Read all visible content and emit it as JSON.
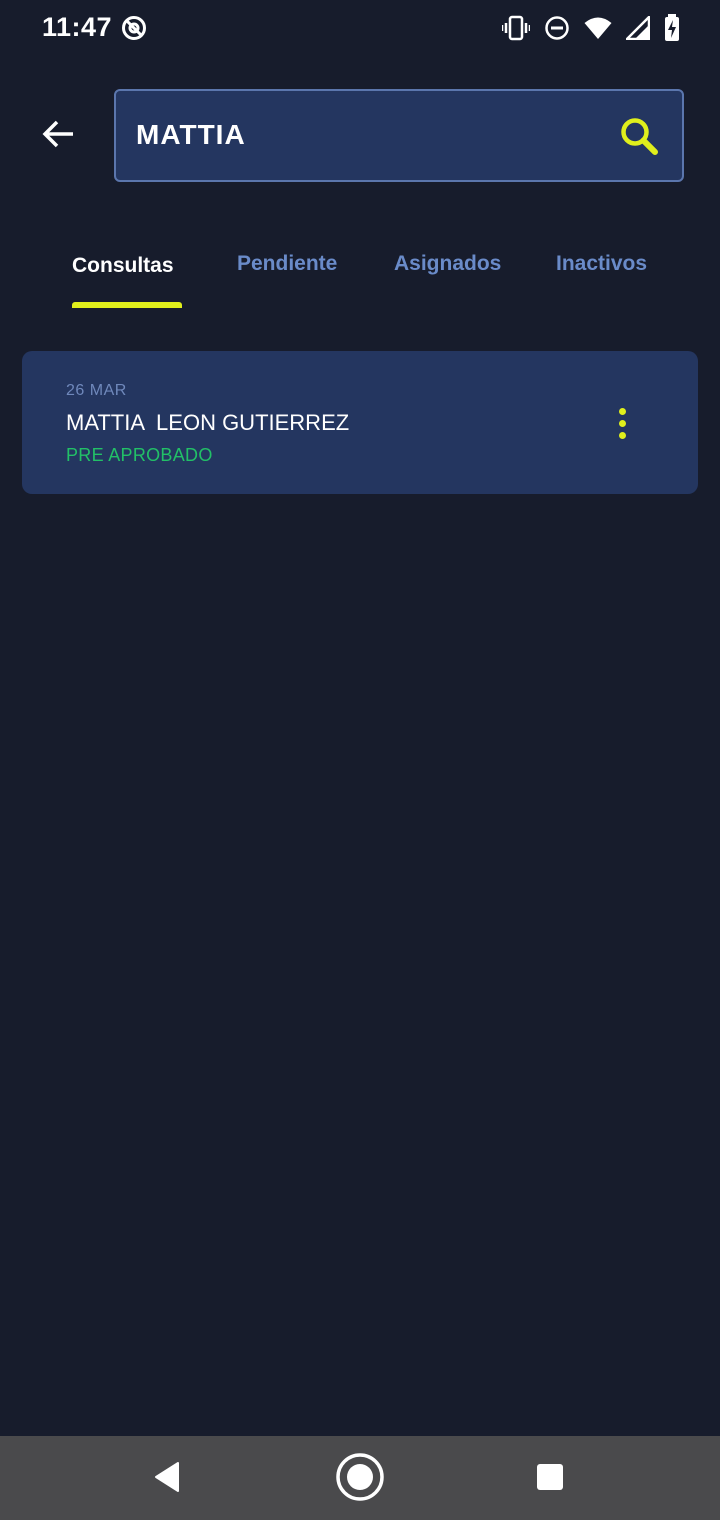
{
  "status_bar": {
    "time": "11:47",
    "left_icon": "at-sign-icon",
    "right_icons": [
      "vibrate-icon",
      "do-not-disturb-icon",
      "wifi-icon",
      "cell-signal-icon",
      "battery-charging-icon"
    ]
  },
  "header": {
    "back_icon": "arrow-left-icon",
    "search": {
      "value": "MATTIA",
      "icon": "search-icon"
    }
  },
  "tabs": [
    {
      "label": "Consultas",
      "active": true
    },
    {
      "label": "Pendiente",
      "active": false
    },
    {
      "label": "Asignados",
      "active": false
    },
    {
      "label": "Inactivos",
      "active": false
    }
  ],
  "results": [
    {
      "date": "26 MAR",
      "name": "MATTIA  LEON GUTIERREZ",
      "status": "PRE APROBADO",
      "menu_icon": "more-vertical-icon"
    }
  ],
  "navigation_bar": {
    "back_icon": "nav-back-icon",
    "home_icon": "nav-home-icon",
    "recents_icon": "nav-recents-icon"
  },
  "colors": {
    "background": "#171c2c",
    "card": "#243660",
    "accent": "#e0ef1c",
    "status_green": "#22c067",
    "tab_inactive": "#6a8bc9",
    "nav_bar": "#4a4a4c"
  }
}
